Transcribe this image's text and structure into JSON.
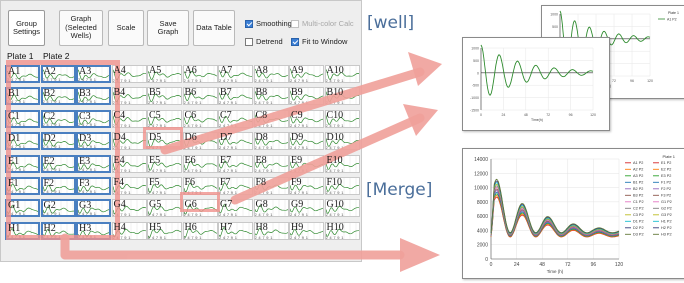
{
  "toolbar": {
    "buttons": [
      {
        "id": "group-settings",
        "label": "Group\nSettings",
        "active": true
      },
      {
        "id": "graph-selected-wells",
        "label": "Graph\n(Selected\nWells)",
        "active": false
      },
      {
        "id": "scale",
        "label": "Scale",
        "active": false
      },
      {
        "id": "save-graph",
        "label": "Save Graph",
        "active": false
      },
      {
        "id": "data-table",
        "label": "Data Table",
        "active": false
      }
    ],
    "checkboxes": [
      {
        "id": "smoothing",
        "label": "Smoothing",
        "checked": true,
        "disabled": false
      },
      {
        "id": "multicolor-calc",
        "label": "Multi-color Calc",
        "checked": false,
        "disabled": true
      },
      {
        "id": "detrend",
        "label": "Detrend",
        "checked": false,
        "disabled": false
      },
      {
        "id": "fit-to-window",
        "label": "Fit to Window",
        "checked": true,
        "disabled": false
      }
    ]
  },
  "plate_tabs": [
    "Plate 1",
    "Plate 2"
  ],
  "plate": {
    "rows": [
      "A",
      "B",
      "C",
      "D",
      "E",
      "F",
      "G",
      "H"
    ],
    "columns": [
      "1",
      "2",
      "3",
      "4",
      "5",
      "6",
      "7",
      "8",
      "9",
      "10"
    ],
    "tick_text": "2 4 7 9 1",
    "selected_columns": [
      "1",
      "2",
      "3"
    ]
  },
  "callouts": {
    "well": "[well]",
    "merge": "[Merge]"
  },
  "well_graph_back": {
    "y_ticks": [
      "1000",
      "500",
      "0",
      "-500",
      "-1000",
      "-1500"
    ],
    "x_ticks": [
      "0",
      "24",
      "48",
      "72",
      "96",
      "120"
    ],
    "xlabel": "Time(h)",
    "legend": [
      "Plate 1",
      "A1 P2"
    ]
  },
  "well_graph_front": {
    "y_ticks": [
      "1000",
      "500",
      "0",
      "-500",
      "-1000",
      "-1500"
    ],
    "x_ticks": [
      "0",
      "24",
      "48",
      "72",
      "96",
      "120"
    ],
    "xlabel": "Time(h)"
  },
  "merge_graph": {
    "title": "Plate 1",
    "xlabel": "Time (h)",
    "y_ticks": [
      "14000",
      "12000",
      "10000",
      "8000",
      "6000",
      "4000",
      "2000",
      "0"
    ],
    "x_ticks": [
      "0",
      "24",
      "48",
      "72",
      "96",
      "120"
    ],
    "legend": [
      "A1 P2",
      "A2 P2",
      "A3 P2",
      "B1 P2",
      "B2 P2",
      "B3 P2",
      "C1 P2",
      "C2 P2",
      "C3 P2",
      "D1 P2",
      "D2 P2",
      "D3 P2",
      "E1 P2",
      "E2 P2",
      "E3 P2",
      "F1 P2",
      "F2 P2",
      "F3 P2",
      "G1 P2",
      "G2 P2",
      "G3 P2",
      "H1 P2",
      "H2 P2",
      "H3 P2"
    ],
    "colors": [
      "#d62728",
      "#ff7f0e",
      "#2ca02c",
      "#1f77b4",
      "#9467bd",
      "#8c564b",
      "#e377c2",
      "#7f7f7f",
      "#bcbd22",
      "#17becf",
      "#393b79",
      "#637939"
    ]
  }
}
